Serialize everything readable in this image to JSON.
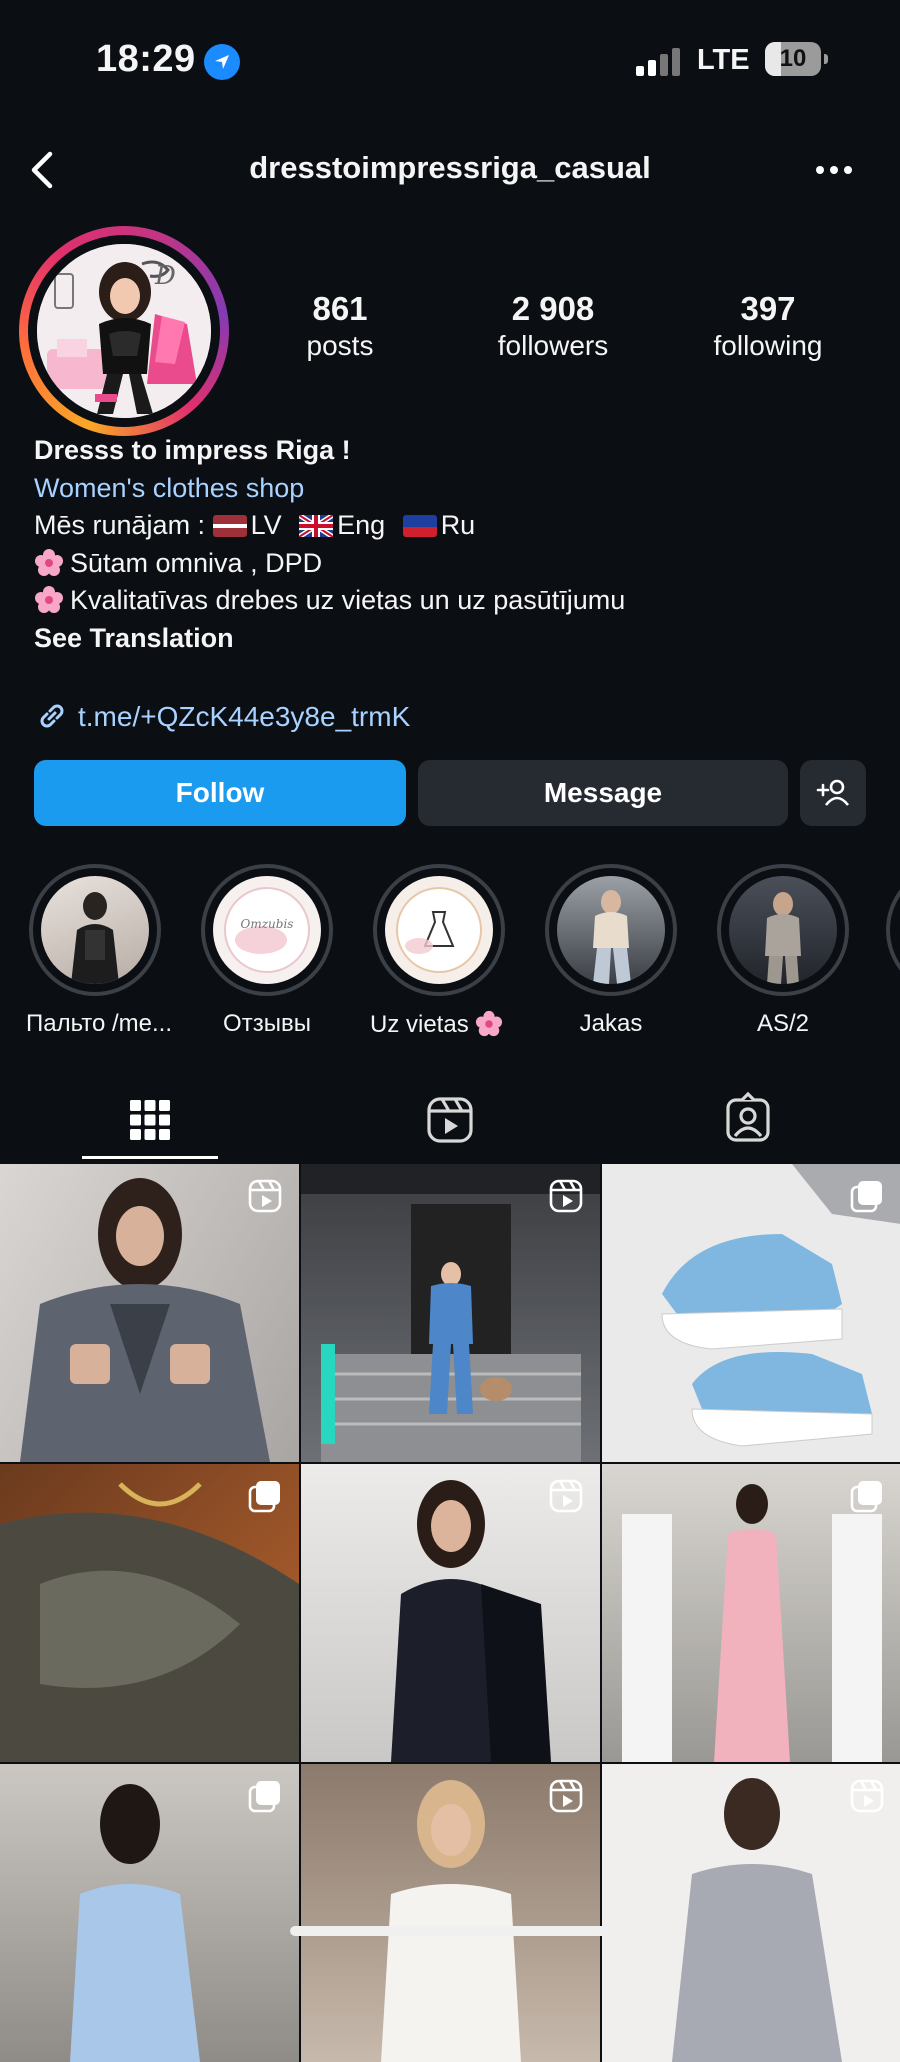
{
  "status_bar": {
    "time": "18:29",
    "network": "LTE",
    "battery": "10"
  },
  "header": {
    "username": "dresstoimpressriga_casual"
  },
  "stats": [
    {
      "value": "861",
      "label": "posts"
    },
    {
      "value": "2 908",
      "label": "followers"
    },
    {
      "value": "397",
      "label": "following"
    }
  ],
  "bio": {
    "name": "Dresss to impress Riga !",
    "category": "Women's clothes shop",
    "languages_prefix": "Mēs runājam :",
    "lang_lv": "LV",
    "lang_eng": "Eng",
    "lang_ru": "Ru",
    "line_shipping": "Sūtam omniva , DPD",
    "line_quality": "Kvalitatīvas drebes uz vietas un uz pasūtījumu",
    "see_translation": "See Translation"
  },
  "link": {
    "text": "t.me/+QZcK44e3y8e_trmK"
  },
  "buttons": {
    "follow": "Follow",
    "message": "Message"
  },
  "highlights": [
    {
      "label": "Пальто /me..."
    },
    {
      "label": "Отзывы"
    },
    {
      "label": "Uz vietas"
    },
    {
      "label": "Jakas"
    },
    {
      "label": "AS/2"
    }
  ],
  "tabs": {
    "active": "grid"
  },
  "colors": {
    "accent": "#1a9bf0",
    "link": "#a8d2ff",
    "background": "#0b0f14"
  }
}
